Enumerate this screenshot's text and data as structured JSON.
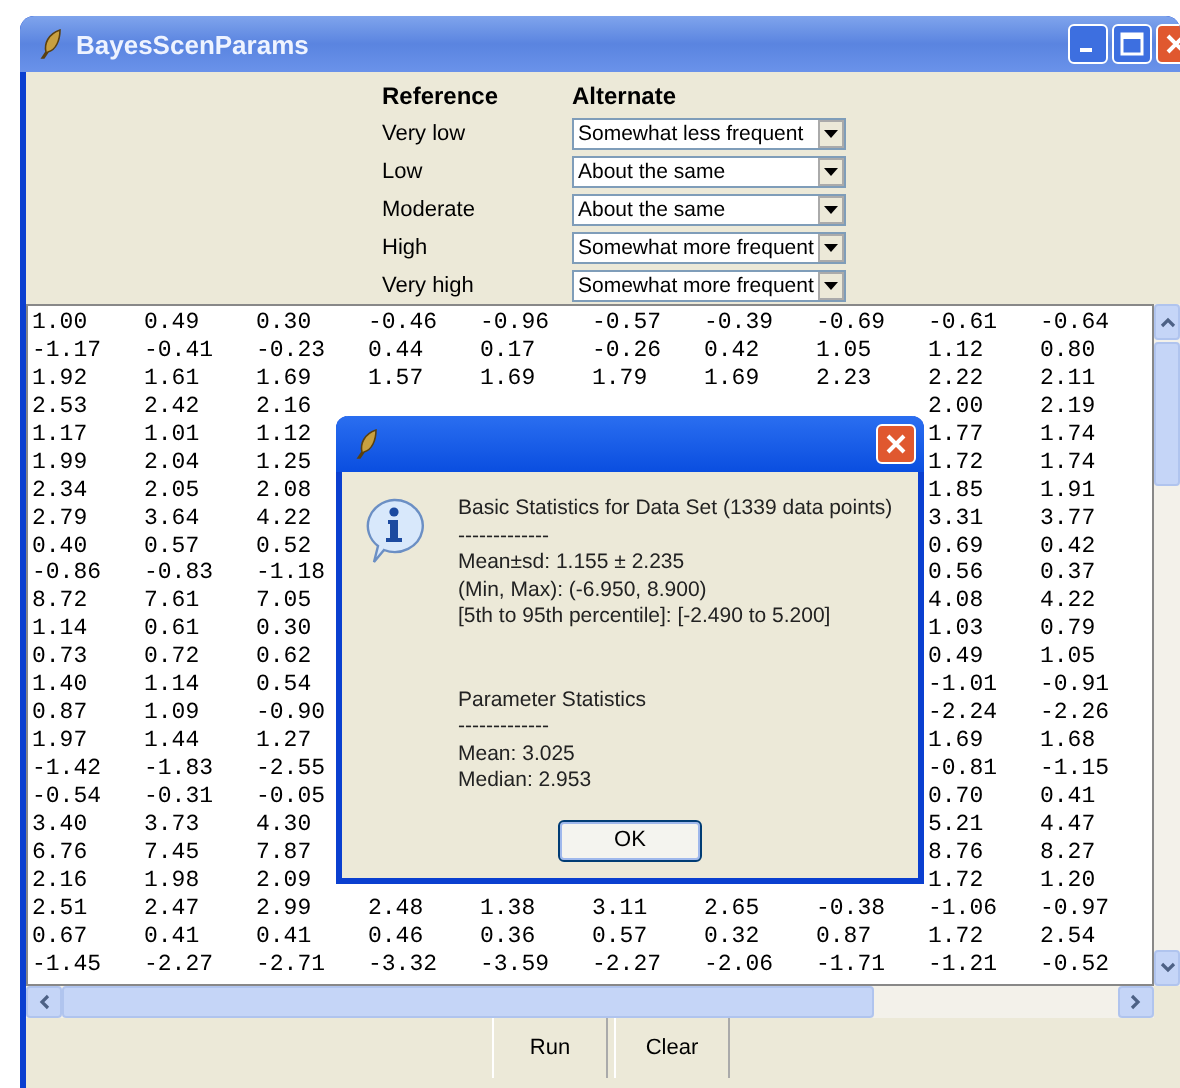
{
  "window": {
    "title": "BayesScenParams"
  },
  "parameters": {
    "reference_heading": "Reference",
    "alternate_heading": "Alternate",
    "rows": [
      {
        "reference": "Very low",
        "alternate": "Somewhat less frequent"
      },
      {
        "reference": "Low",
        "alternate": "About the same"
      },
      {
        "reference": "Moderate",
        "alternate": "About the same"
      },
      {
        "reference": "High",
        "alternate": "Somewhat more frequent"
      },
      {
        "reference": "Very high",
        "alternate": "Somewhat more frequent"
      }
    ]
  },
  "data_table": {
    "rows": [
      [
        "1.00",
        "0.49",
        "0.30",
        "-0.46",
        "-0.96",
        "-0.57",
        "-0.39",
        "-0.69",
        "-0.61",
        "-0.64"
      ],
      [
        "-1.17",
        "-0.41",
        "-0.23",
        "0.44",
        "0.17",
        "-0.26",
        "0.42",
        "1.05",
        "1.12",
        "0.80"
      ],
      [
        "1.92",
        "1.61",
        "1.69",
        "1.57",
        "1.69",
        "1.79",
        "1.69",
        "2.23",
        "2.22",
        "2.11"
      ],
      [
        "2.53",
        "2.42",
        "2.16",
        null,
        null,
        null,
        null,
        null,
        "2.00",
        "2.19"
      ],
      [
        "1.17",
        "1.01",
        "1.12",
        null,
        null,
        null,
        null,
        null,
        "1.77",
        "1.74"
      ],
      [
        "1.99",
        "2.04",
        "1.25",
        null,
        null,
        null,
        null,
        null,
        "1.72",
        "1.74"
      ],
      [
        "2.34",
        "2.05",
        "2.08",
        null,
        null,
        null,
        null,
        null,
        "1.85",
        "1.91"
      ],
      [
        "2.79",
        "3.64",
        "4.22",
        null,
        null,
        null,
        null,
        null,
        "3.31",
        "3.77"
      ],
      [
        "0.40",
        "0.57",
        "0.52",
        null,
        null,
        null,
        null,
        null,
        "0.69",
        "0.42"
      ],
      [
        "-0.86",
        "-0.83",
        "-1.18",
        null,
        null,
        null,
        null,
        null,
        "0.56",
        "0.37"
      ],
      [
        "8.72",
        "7.61",
        "7.05",
        null,
        null,
        null,
        null,
        null,
        "4.08",
        "4.22"
      ],
      [
        "1.14",
        "0.61",
        "0.30",
        null,
        null,
        null,
        null,
        null,
        "1.03",
        "0.79"
      ],
      [
        "0.73",
        "0.72",
        "0.62",
        null,
        null,
        null,
        null,
        null,
        "0.49",
        "1.05"
      ],
      [
        "1.40",
        "1.14",
        "0.54",
        null,
        null,
        null,
        null,
        null,
        "-1.01",
        "-0.91"
      ],
      [
        "0.87",
        "1.09",
        "-0.90",
        null,
        null,
        null,
        null,
        null,
        "-2.24",
        "-2.26"
      ],
      [
        "1.97",
        "1.44",
        "1.27",
        null,
        null,
        null,
        null,
        null,
        "1.69",
        "1.68"
      ],
      [
        "-1.42",
        "-1.83",
        "-2.55",
        null,
        null,
        null,
        null,
        null,
        "-0.81",
        "-1.15"
      ],
      [
        "-0.54",
        "-0.31",
        "-0.05",
        null,
        null,
        null,
        null,
        null,
        "0.70",
        "0.41"
      ],
      [
        "3.40",
        "3.73",
        "4.30",
        null,
        null,
        null,
        null,
        null,
        "5.21",
        "4.47"
      ],
      [
        "6.76",
        "7.45",
        "7.87",
        null,
        null,
        null,
        null,
        null,
        "8.76",
        "8.27"
      ],
      [
        "2.16",
        "1.98",
        "2.09",
        null,
        null,
        null,
        null,
        null,
        "1.72",
        "1.20"
      ],
      [
        "2.51",
        "2.47",
        "2.99",
        "2.48",
        "1.38",
        "3.11",
        "2.65",
        "-0.38",
        "-1.06",
        "-0.97"
      ],
      [
        "0.67",
        "0.41",
        "0.41",
        "0.46",
        "0.36",
        "0.57",
        "0.32",
        "0.87",
        "1.72",
        "2.54"
      ],
      [
        "-1.45",
        "-2.27",
        "-2.71",
        "-3.32",
        "-3.59",
        "-2.27",
        "-2.06",
        "-1.71",
        "-1.21",
        "-0.52"
      ]
    ]
  },
  "buttons": [
    "Run",
    "Clear"
  ],
  "dialog": {
    "lines": [
      "Basic Statistics for Data Set (1339 data points)",
      "-------------",
      "Mean±sd: 1.155 ± 2.235",
      "(Min, Max): (-6.950, 8.900)",
      "[5th to 95th percentile]: [-2.490 to 5.200]"
    ],
    "lines_2": [
      "Parameter Statistics",
      "-------------",
      "Mean: 3.025",
      "Median: 2.953"
    ],
    "ok_button": "OK"
  }
}
